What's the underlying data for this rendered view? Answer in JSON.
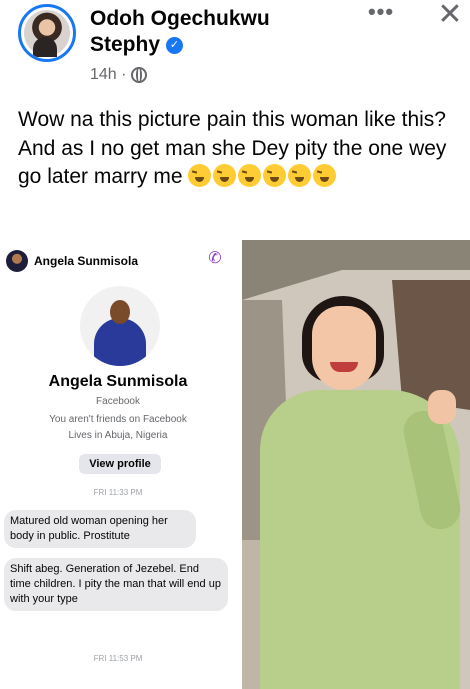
{
  "post": {
    "author_first": "Odoh Ogechukwu",
    "author_second": "Stephy",
    "time": "14h ·",
    "text_line1": "Wow na this picture pain this woman like this?",
    "text_line2": "And as I no get man she Dey pity the one wey go later marry me",
    "emoji_count": 6,
    "icons": {
      "verified": "verified-badge-icon",
      "privacy": "globe-icon",
      "more": "more-options-icon",
      "close": "close-icon"
    }
  },
  "screenshot": {
    "chat_name": "Angela Sunmisola",
    "profile_name": "Angela Sunmisola",
    "platform": "Facebook",
    "friend_status": "You aren't friends on Facebook",
    "location": "Lives in Abuja, Nigeria",
    "view_profile_label": "View profile",
    "timestamp1": "FRI 11:33 PM",
    "message1": "Matured old woman opening her body in public. Prostitute",
    "message2": "Shift abeg. Generation of Jezebel. End time children. I pity the man that will end up with your type",
    "timestamp2": "FRI 11:53 PM"
  },
  "colors": {
    "accent": "#1877f2",
    "secondary_text": "#65676b",
    "call_icon": "#8a3cd0",
    "bubble": "#e9e9eb"
  }
}
